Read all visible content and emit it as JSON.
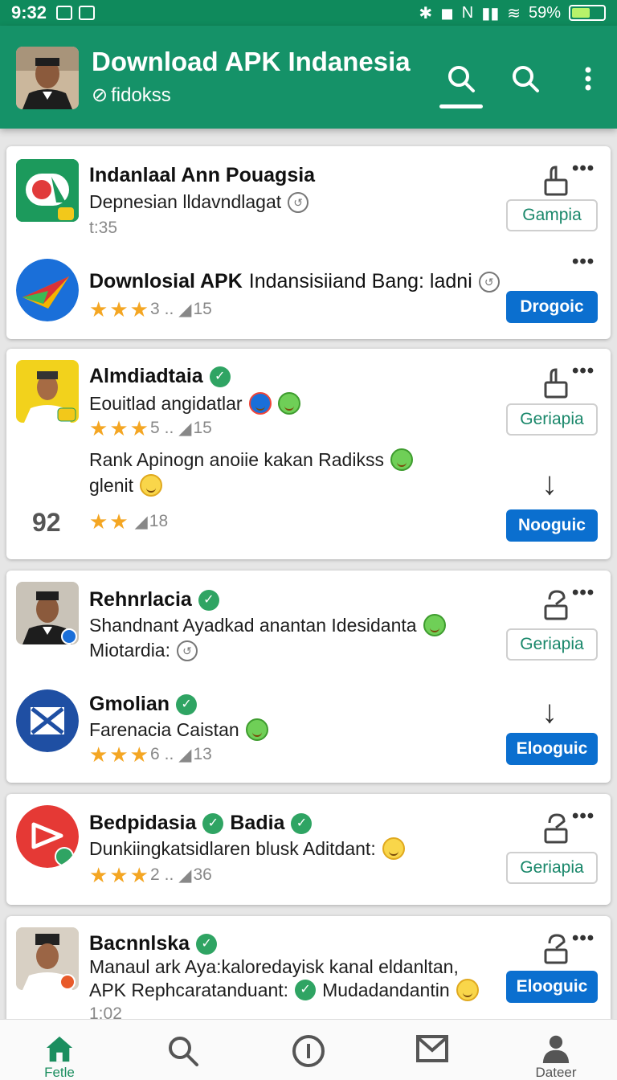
{
  "status_bar": {
    "time": "9:32",
    "battery": "59%",
    "battery_level": 0.59,
    "icons": [
      "bluetooth-icon",
      "camera-icon",
      "nfc-icon",
      "signal-icon",
      "wifi-icon"
    ]
  },
  "app_bar": {
    "title": "Download APK Indanesia",
    "subtitle": "fidokss",
    "icons": [
      "search-icon",
      "search-icon",
      "more-vert-icon"
    ],
    "colors": {
      "primary": "#159268",
      "status": "#0f8a5c"
    }
  },
  "cards": [
    {
      "rows": [
        {
          "name": "Indanlaal Ann Pouagsia",
          "desc": "Depnesian lldavndlagat",
          "meta": "t:35",
          "action": "Gampia",
          "action_style": "outline",
          "icon": "app-icon-red-green"
        },
        {
          "name": "Downlosial APK",
          "name_extra": "Indansisiiand Bang: ladni",
          "rating_stars": 3,
          "rating_count": "3",
          "meta_sep": "..",
          "meta_count": "15",
          "action": "Drogoic",
          "action_style": "filled",
          "icon": "play-store-icon"
        }
      ]
    },
    {
      "rows": [
        {
          "name": "Almdiadtaia",
          "desc": "Eouitlad angidatlar",
          "rating_stars": 3,
          "rating_count": "5",
          "meta_sep": "..",
          "meta_count": "15",
          "action": "Geriapia",
          "action_style": "outline",
          "icon": "profile-yellow-icon"
        },
        {
          "comment_line1": "Rank Apinogn anoiie kakan Radikss",
          "comment_line2": "glenit",
          "big_number": "92",
          "rating_stars": 2,
          "meta_count": "18",
          "action": "Nooguic",
          "action_style": "filled"
        }
      ]
    },
    {
      "rows": [
        {
          "name": "Rehnrlacia",
          "desc": "Shandnant Ayadkad anantan Idesidanta",
          "desc2": "Miotardia:",
          "action": "Geriapia",
          "action_style": "outline",
          "icon": "profile-avatar-icon"
        },
        {
          "name": "Gmolian",
          "desc": "Farenacia Caistan",
          "rating_stars": 3,
          "rating_count": "6",
          "meta_sep": "..",
          "meta_count": "13",
          "action": "Elooguic",
          "action_style": "filled",
          "icon": "mail-app-icon"
        }
      ]
    },
    {
      "rows": [
        {
          "name": "Bedpidasia",
          "name2": "Badia",
          "desc": "Dunkiingkatsidlaren blusk Aditdant:",
          "rating_stars": 3,
          "rating_count": "2",
          "meta_sep": "..",
          "meta_count": "36",
          "action": "Geriapia",
          "action_style": "outline",
          "icon": "video-app-icon"
        }
      ]
    },
    {
      "rows": [
        {
          "name": "Bacnnlska",
          "desc": "Manaul ark Aya:kaloredayisk kanal eldanltan,",
          "desc2": "APK Rephcaratanduant:",
          "desc2_extra": "Mudadandantin",
          "meta": "1:02",
          "action": "Elooguic",
          "action_style": "filled",
          "icon": "profile-batik-icon"
        }
      ]
    }
  ],
  "bottom_nav": [
    {
      "label": "Fetle",
      "icon": "home-icon",
      "active": true
    },
    {
      "label": "",
      "icon": "search-icon",
      "active": false
    },
    {
      "label": "",
      "icon": "info-icon",
      "active": false
    },
    {
      "label": "",
      "icon": "mail-icon",
      "active": false
    },
    {
      "label": "Dateer",
      "icon": "person-icon",
      "active": false
    }
  ]
}
